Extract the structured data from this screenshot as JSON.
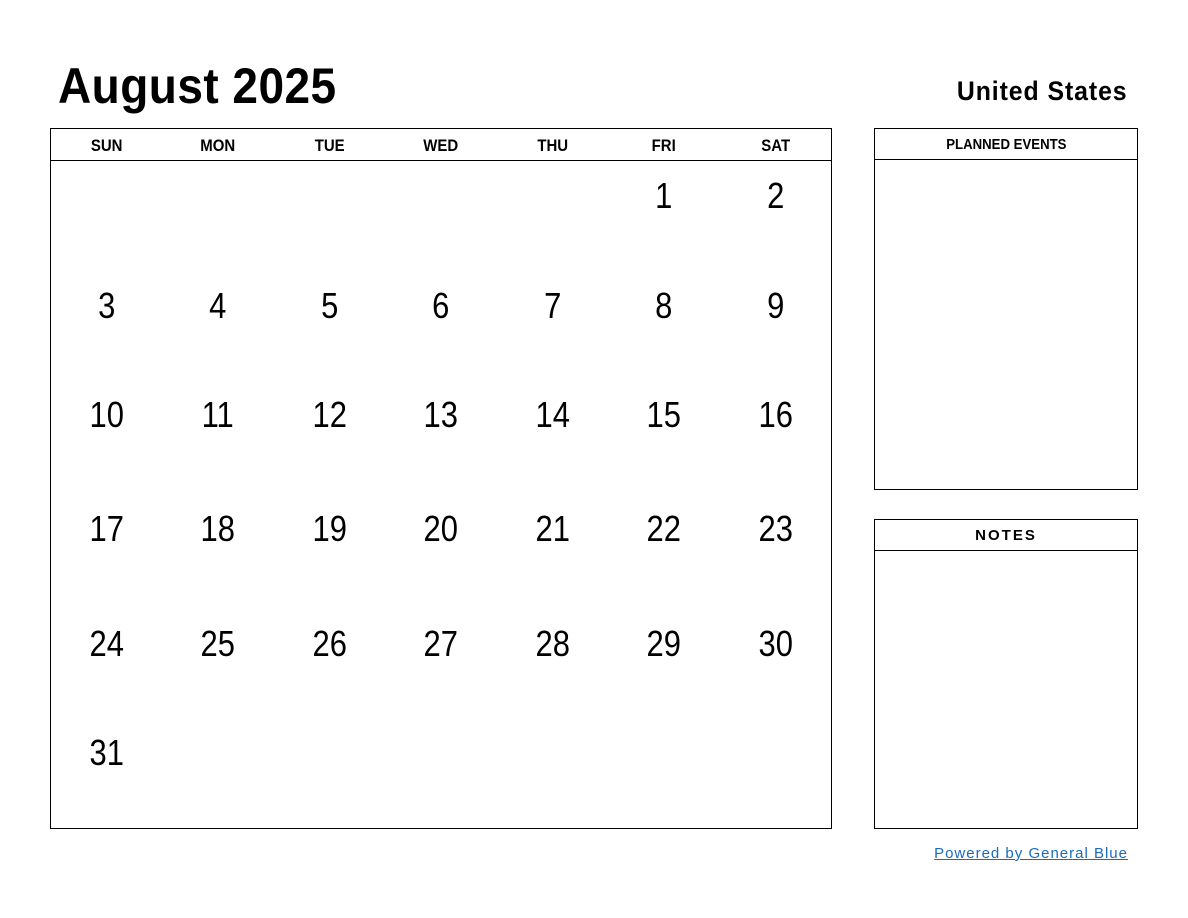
{
  "header": {
    "title": "August 2025",
    "country": "United States"
  },
  "calendar": {
    "weekdays": [
      "SUN",
      "MON",
      "TUE",
      "WED",
      "THU",
      "FRI",
      "SAT"
    ],
    "first_weekday_index": 5,
    "weeks": [
      [
        "",
        "",
        "",
        "",
        "",
        "1",
        "2"
      ],
      [
        "3",
        "4",
        "5",
        "6",
        "7",
        "8",
        "9"
      ],
      [
        "10",
        "11",
        "12",
        "13",
        "14",
        "15",
        "16"
      ],
      [
        "17",
        "18",
        "19",
        "20",
        "21",
        "22",
        "23"
      ],
      [
        "24",
        "25",
        "26",
        "27",
        "28",
        "29",
        "30"
      ],
      [
        "31",
        "",
        "",
        "",
        "",
        "",
        ""
      ]
    ]
  },
  "panels": {
    "planned_events": {
      "title": "PLANNED EVENTS"
    },
    "notes": {
      "title": "NOTES"
    }
  },
  "footer": {
    "link_text": "Powered by General Blue",
    "link_color": "#1a6bbd"
  }
}
